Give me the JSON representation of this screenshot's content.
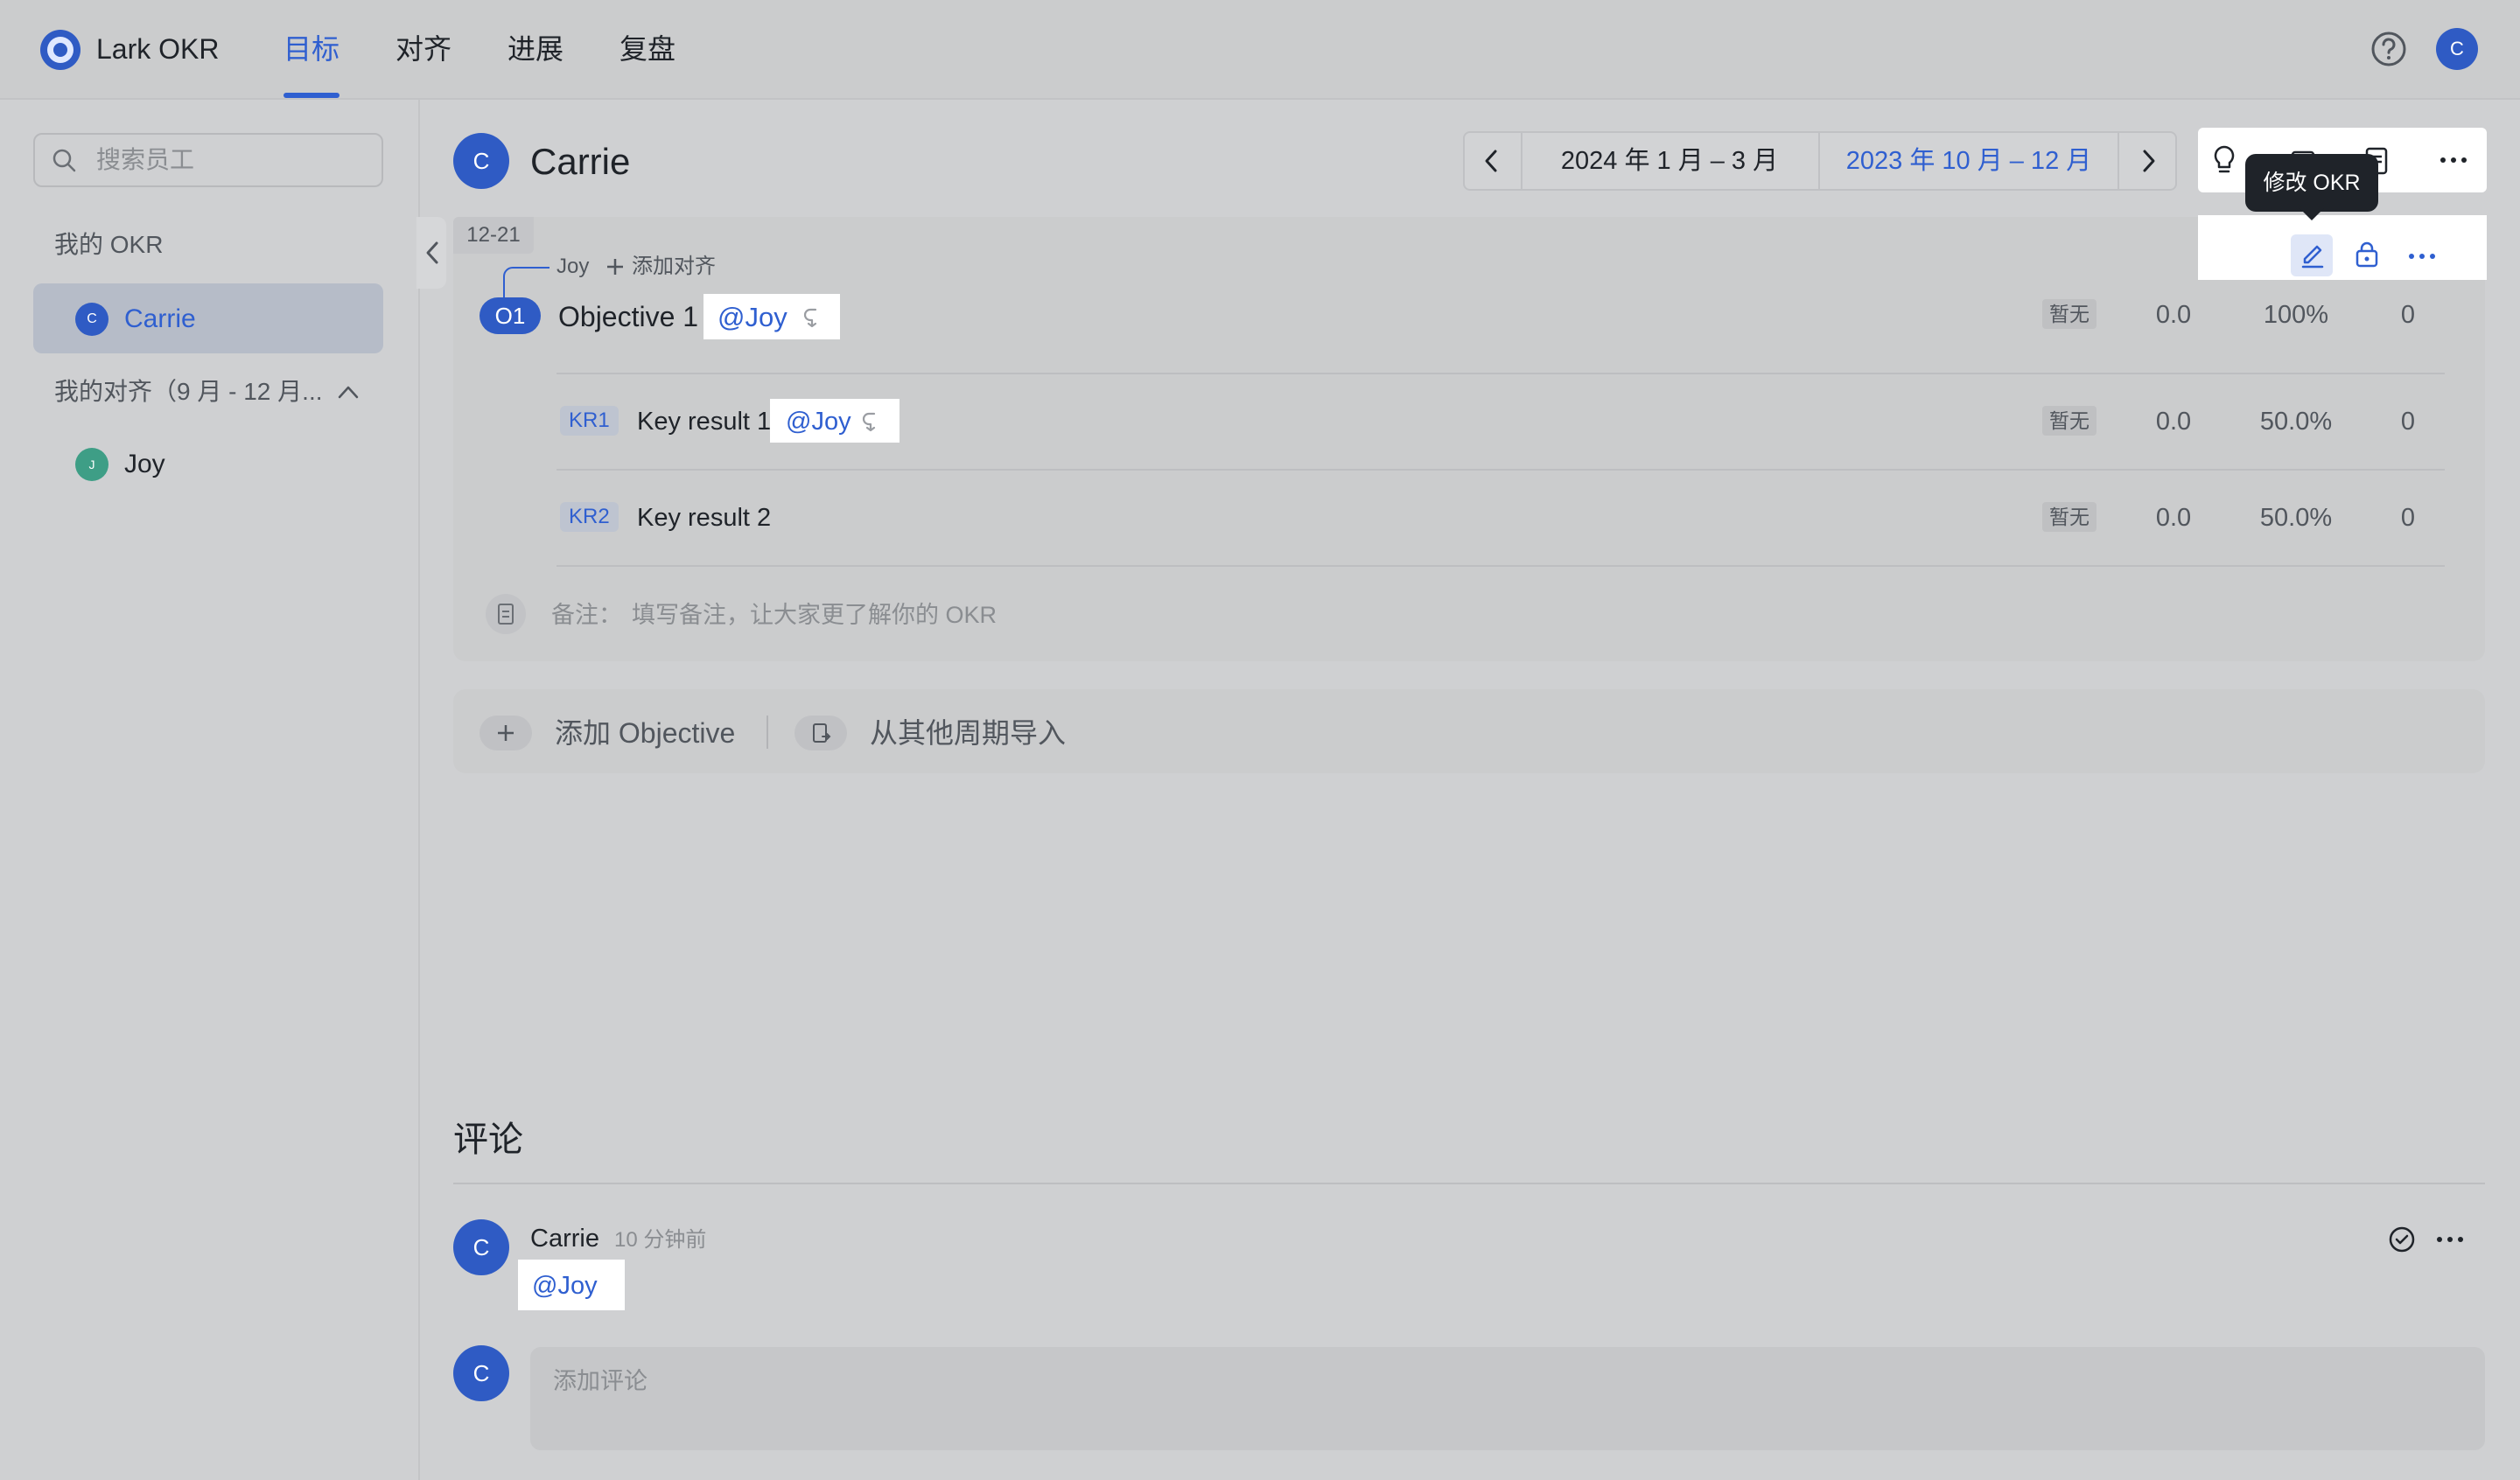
{
  "app": {
    "title": "Lark OKR"
  },
  "nav": {
    "tabs": [
      "目标",
      "对齐",
      "进展",
      "复盘"
    ],
    "active": "目标"
  },
  "header": {
    "avatar_initial": "C"
  },
  "sidebar": {
    "search_placeholder": "搜索员工",
    "my_okr_label": "我的 OKR",
    "my_okr_items": [
      {
        "name": "Carrie",
        "initial": "C",
        "selected": true
      }
    ],
    "my_alignment_label": "我的对齐（9 月 - 12 月...",
    "alignment_items": [
      {
        "name": "Joy",
        "initial": "J"
      }
    ]
  },
  "owner": {
    "name": "Carrie",
    "initial": "C"
  },
  "period": {
    "current": "2024 年 1 月 – 3 月",
    "selected": "2023 年 10 月 – 12 月"
  },
  "tooltip": "修改 OKR",
  "okr": {
    "date_badge": "12-21",
    "aligned_parent": "Joy",
    "add_alignment_label": "添加对齐",
    "objective": {
      "badge": "O1",
      "title": "Objective 1",
      "mention": "@Joy",
      "status": "暂无",
      "score": "0.0",
      "progress": "100%",
      "count": "0"
    },
    "key_results": [
      {
        "badge": "KR1",
        "title": "Key result 1",
        "mention": "@Joy",
        "status": "暂无",
        "score": "0.0",
        "progress": "50.0%",
        "count": "0"
      },
      {
        "badge": "KR2",
        "title": "Key result 2",
        "mention": "",
        "status": "暂无",
        "score": "0.0",
        "progress": "50.0%",
        "count": "0"
      }
    ],
    "note_label": "备注：",
    "note_placeholder": "填写备注，让大家更了解你的 OKR"
  },
  "actions": {
    "add_objective": "添加 Objective",
    "import_from_other": "从其他周期导入"
  },
  "comments": {
    "title": "评论",
    "items": [
      {
        "author": "Carrie",
        "initial": "C",
        "time": "10 分钟前",
        "text": "@Joy"
      }
    ],
    "input_placeholder": "添加评论",
    "input_avatar_initial": "C"
  },
  "colors": {
    "accent": "#2f5fd0",
    "avatar_blue": "#2f5bc4",
    "avatar_green": "#3e9e86"
  }
}
